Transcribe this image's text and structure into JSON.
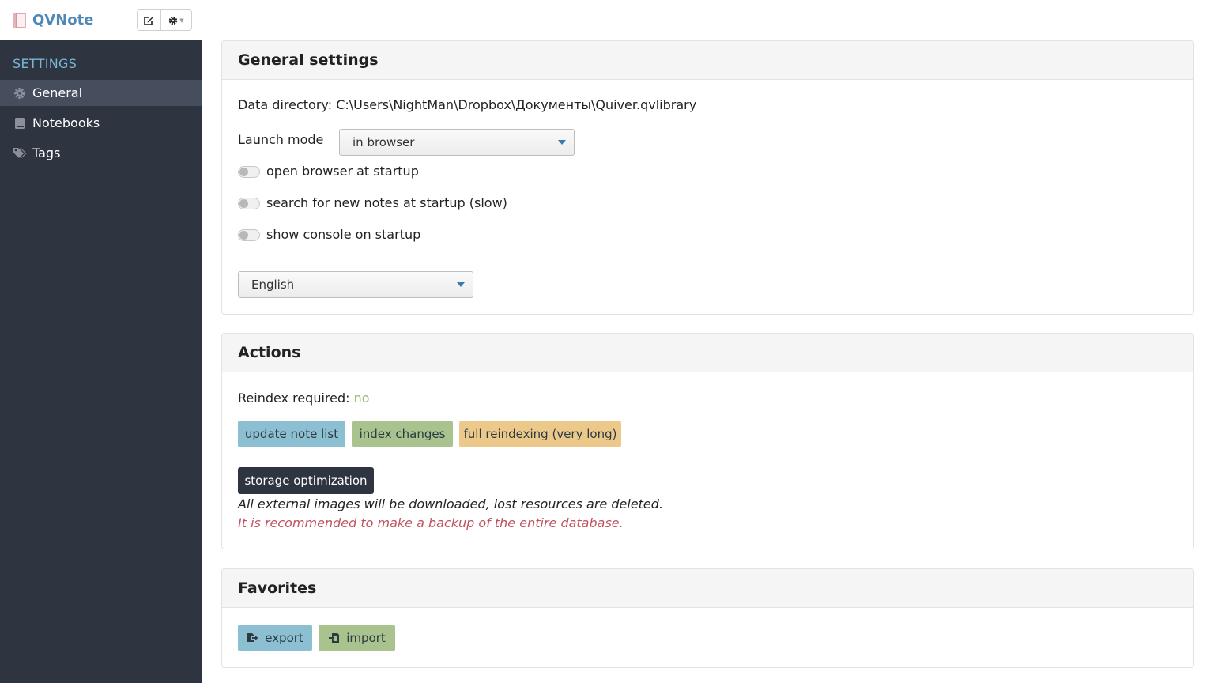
{
  "app": {
    "title": "QVNote"
  },
  "sidebar": {
    "heading": "SETTINGS",
    "items": [
      {
        "label": "General",
        "icon": "gear-icon",
        "active": true
      },
      {
        "label": "Notebooks",
        "icon": "book-icon",
        "active": false
      },
      {
        "label": "Tags",
        "icon": "tags-icon",
        "active": false
      }
    ]
  },
  "general": {
    "title": "General settings",
    "data_directory_label": "Data directory:",
    "data_directory_value": "C:\\Users\\NightMan\\Dropbox\\Документы\\Quiver.qvlibrary",
    "launch_mode_label": "Launch mode",
    "launch_mode_value": "in browser",
    "toggles": [
      {
        "label": "open browser at startup",
        "on": false
      },
      {
        "label": "search for new notes at startup (slow)",
        "on": false
      },
      {
        "label": "show console on startup",
        "on": false
      }
    ],
    "language_value": "English"
  },
  "actions": {
    "title": "Actions",
    "reindex_label": "Reindex required:",
    "reindex_value": "no",
    "update_button": "update note list",
    "index_button": "index changes",
    "full_reindex_button": "full reindexing (very long)",
    "storage_button": "storage optimization",
    "note_line1": "All external images will be downloaded, lost resources are deleted.",
    "note_line2": "It is recommended to make a backup of the entire database."
  },
  "favorites": {
    "title": "Favorites",
    "export_button": "export",
    "import_button": "import"
  },
  "colors": {
    "sidebar_bg": "#2e3440",
    "accent_blue": "#8cbfd2",
    "accent_green": "#a9c28e",
    "accent_yellow": "#ecc98a",
    "warning_red": "#c0525d",
    "status_green": "#8fbf6f"
  }
}
